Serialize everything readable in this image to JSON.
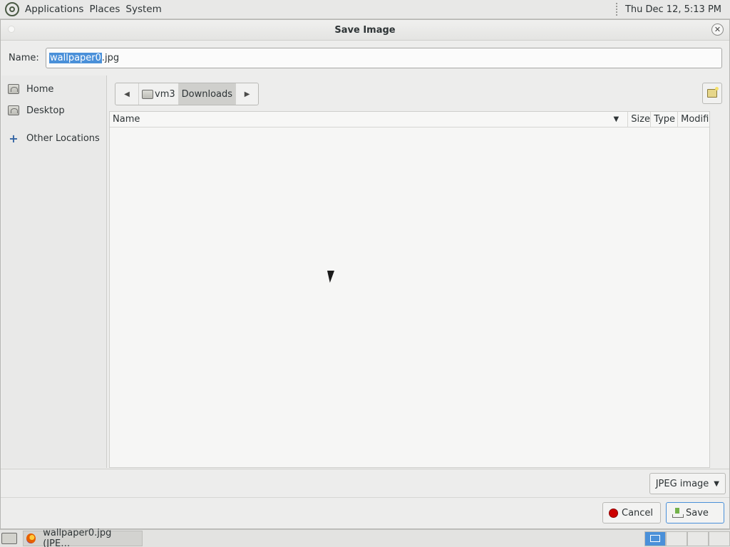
{
  "top_panel": {
    "menus": [
      "Applications",
      "Places",
      "System"
    ],
    "clock": "Thu Dec 12,  5:13 PM"
  },
  "dialog": {
    "title": "Save Image",
    "name_label": "Name:",
    "file_name_selected": "wallpaper0",
    "file_name_rest": ".jpg"
  },
  "sidebar": {
    "items": [
      {
        "label": "Home",
        "icon": "home-folder-icon"
      },
      {
        "label": "Desktop",
        "icon": "desktop-folder-icon"
      },
      {
        "label": "Other Locations",
        "icon": "plus-icon"
      }
    ]
  },
  "pathbar": {
    "crumbs": [
      "vm3",
      "Downloads"
    ],
    "active": "Downloads"
  },
  "file_list": {
    "columns": [
      "Name",
      "Size",
      "Type",
      "Modifi"
    ],
    "rows": []
  },
  "filter": {
    "selected": "JPEG image"
  },
  "actions": {
    "cancel_label": "Cancel",
    "save_label": "Save"
  },
  "taskbar": {
    "task_label": "wallpaper0.jpg (JPE…"
  },
  "colors": {
    "selection": "#4a90d9",
    "cancel_icon": "#cc0000",
    "save_icon": "#73b14a"
  }
}
